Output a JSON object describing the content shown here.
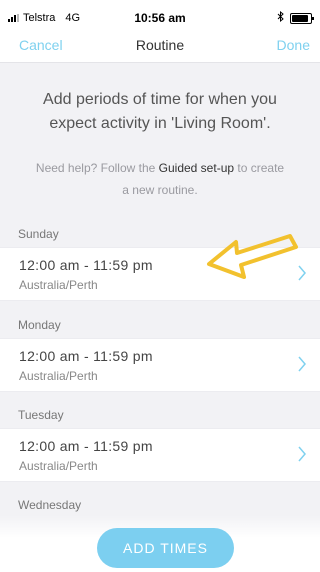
{
  "status_bar": {
    "carrier": "Telstra",
    "network": "4G",
    "time": "10:56 am"
  },
  "nav": {
    "cancel_label": "Cancel",
    "title": "Routine",
    "done_label": "Done"
  },
  "intro": {
    "line1": "Add periods of time for when you",
    "line2": "expect activity in 'Living Room'."
  },
  "help": {
    "prefix": "Need help? Follow the ",
    "link": "Guided set-up",
    "suffix": " to create",
    "line2": "a new routine."
  },
  "days": [
    {
      "name": "Sunday",
      "time": "12:00 am - 11:59 pm",
      "timezone": "Australia/Perth"
    },
    {
      "name": "Monday",
      "time": "12:00 am - 11:59 pm",
      "timezone": "Australia/Perth"
    },
    {
      "name": "Tuesday",
      "time": "12:00 am - 11:59 pm",
      "timezone": "Australia/Perth"
    },
    {
      "name": "Wednesday"
    }
  ],
  "add_button_label": "ADD TIMES",
  "colors": {
    "accent": "#7ccff0",
    "annotation_arrow": "#f2c12e"
  }
}
